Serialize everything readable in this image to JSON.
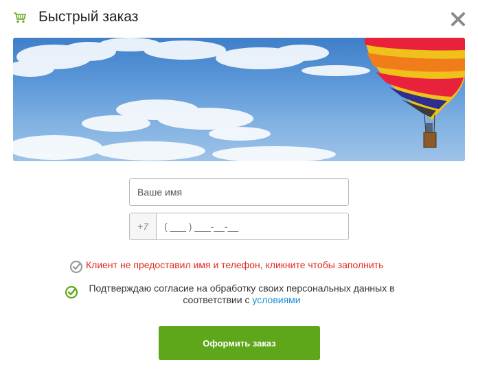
{
  "dialog": {
    "title": "Быстрый заказ",
    "icons": {
      "cart": "cart-icon",
      "close": "close-icon"
    }
  },
  "banner": {
    "image": "hot-air-balloon-sky"
  },
  "form": {
    "name_placeholder": "Ваше имя",
    "phone_prefix": "+7",
    "phone_placeholder": "( ___ ) ___-__-__"
  },
  "validation": {
    "message": "Клиент не предоставил имя и телефон, кликните чтобы заполнить",
    "color": "#e0291f",
    "icon": "check-circle-gray-icon"
  },
  "consent": {
    "text": "Подтверждаю согласие на обработку своих персональных данных в соответствии с",
    "link_label": "условиями",
    "link_color": "#1a8fd6",
    "icon": "check-circle-green-icon",
    "checked": true
  },
  "actions": {
    "submit_label": "Оформить заказ",
    "submit_color": "#5ea61a"
  }
}
